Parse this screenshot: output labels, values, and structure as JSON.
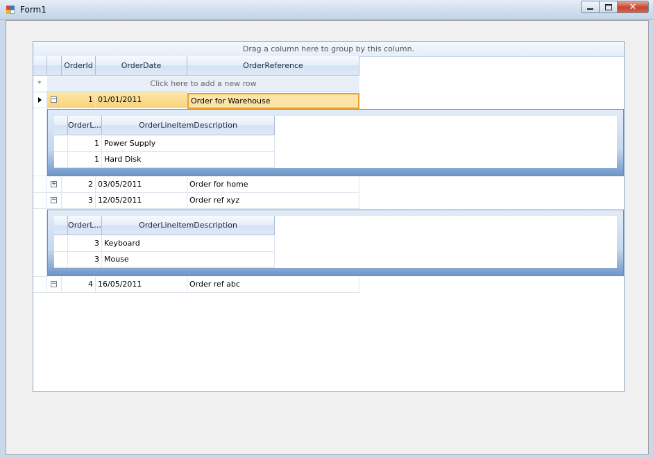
{
  "window": {
    "title": "Form1"
  },
  "grid": {
    "group_panel_text": "Drag a column here to group by this column.",
    "columns": [
      "OrderId",
      "OrderDate",
      "OrderReference"
    ],
    "new_row_text": "Click here to add a new row",
    "new_row_marker": "*",
    "rows": [
      {
        "id": "1",
        "date": "01/01/2011",
        "ref": "Order for Warehouse",
        "expanded": true,
        "selected": true,
        "children": [
          {
            "qty": "1",
            "desc": "Power Supply"
          },
          {
            "qty": "1",
            "desc": "Hard Disk"
          }
        ]
      },
      {
        "id": "2",
        "date": "03/05/2011",
        "ref": "Order for home",
        "expanded": false,
        "children": []
      },
      {
        "id": "3",
        "date": "12/05/2011",
        "ref": "Order ref xyz",
        "expanded": true,
        "children": [
          {
            "qty": "3",
            "desc": "Keyboard"
          },
          {
            "qty": "3",
            "desc": "Mouse"
          }
        ]
      },
      {
        "id": "4",
        "date": "16/05/2011",
        "ref": "Order ref abc",
        "expanded": true,
        "children": []
      }
    ],
    "child_columns": [
      "OrderL...",
      "OrderLineItemDescription"
    ]
  },
  "glyphs": {
    "expanded": "−",
    "collapsed": "+",
    "close": "✕"
  }
}
